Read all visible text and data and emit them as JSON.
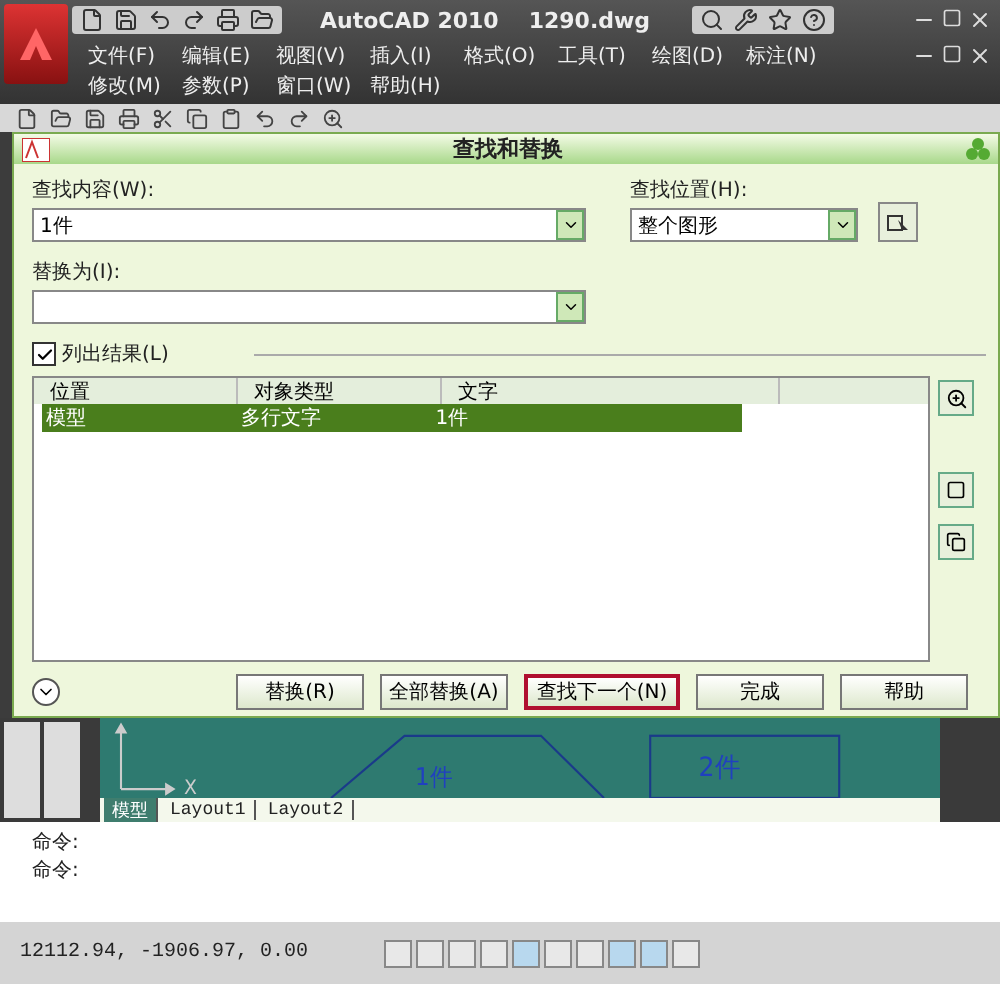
{
  "title_bar": {
    "app_title": "AutoCAD 2010",
    "file_name": "1290.dwg"
  },
  "menu_rows": [
    [
      "文件(F)",
      "编辑(E)",
      "视图(V)",
      "插入(I)",
      "格式(O)",
      "工具(T)",
      "绘图(D)",
      "标注(N)"
    ],
    [
      "修改(M)",
      "参数(P)",
      "窗口(W)",
      "帮助(H)"
    ]
  ],
  "dialog": {
    "title": "查找和替换",
    "find_label": "查找内容(W):",
    "find_value": "1件",
    "location_label": "查找位置(H):",
    "location_value": "整个图形",
    "replace_label": "替换为(I):",
    "list_results": {
      "label": "列出结果(L)",
      "checked": true
    },
    "columns": [
      "位置",
      "对象类型",
      "文字"
    ],
    "rows": [
      {
        "cells": [
          "模型",
          "多行文字",
          "1件"
        ],
        "selected": true
      }
    ],
    "buttons": [
      {
        "label": "替换(R)",
        "highlighted": false
      },
      {
        "label": "全部替换(A)",
        "highlighted": false
      },
      {
        "label": "查找下一个(N)",
        "highlighted": true
      },
      {
        "label": "完成",
        "highlighted": false
      },
      {
        "label": "帮助",
        "highlighted": false
      }
    ]
  },
  "drawing": {
    "axis_label": "X",
    "labels": [
      "1件",
      "2件"
    ],
    "tabs": [
      {
        "label": "模型",
        "selected": true
      },
      {
        "label": "Layout1",
        "selected": false
      },
      {
        "label": "Layout2",
        "selected": false
      }
    ]
  },
  "command_lines": [
    "命令:",
    "命令:"
  ],
  "status_bar": {
    "coordinates": "12112.94, -1906.97, 0.00"
  }
}
